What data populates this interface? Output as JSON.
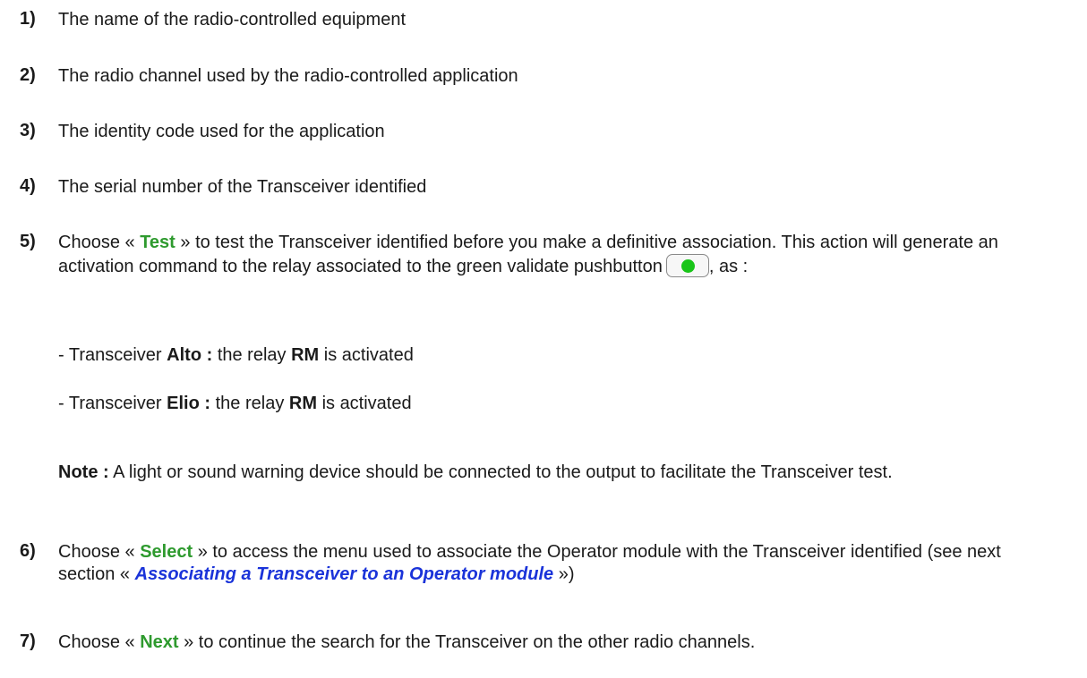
{
  "items": [
    {
      "num": "1)",
      "text": "The name of the radio-controlled equipment"
    },
    {
      "num": "2)",
      "text": "The radio channel used by the radio-controlled application"
    },
    {
      "num": "3)",
      "text": "The identity code used for the application"
    },
    {
      "num": "4)",
      "text": "The serial number of the Transceiver identified"
    },
    {
      "num": "5)",
      "choose": "Choose «",
      "button": "Test",
      "after_button": "» to test the Transceiver identified before you make a definitive association. This action will generate an activation command to the relay associated to the green validate pushbutton",
      "after_icon": ", as :",
      "sub_items": [
        {
          "prefix": "- Transceiver",
          "model": "Alto :",
          "middle": "the relay",
          "relay": "RM",
          "suffix": "is activated"
        },
        {
          "prefix": "- Transceiver",
          "model": "Elio :",
          "middle": "the relay",
          "relay": "RM",
          "suffix": "is activated"
        }
      ],
      "note_label": "Note :",
      "note_text": "A light or sound warning device should be connected to the output to facilitate the Transceiver test."
    },
    {
      "num": "6)",
      "choose": "Choose «",
      "button": "Select",
      "after_button": "» to access the menu used to associate the Operator module with the Transceiver identified (see next section «",
      "link": "Associating a Transceiver to an Operator module",
      "after_link": "»)"
    },
    {
      "num": "7)",
      "choose": "Choose «",
      "button": "Next",
      "after_button": "» to continue the search for the Transceiver on the other radio channels."
    }
  ],
  "colors": {
    "button_green": "#2e9a2e",
    "link_blue": "#1a33d9",
    "led_green": "#19c519"
  },
  "icons": {
    "validate_pushbutton": "green-led-pushbutton-icon"
  }
}
